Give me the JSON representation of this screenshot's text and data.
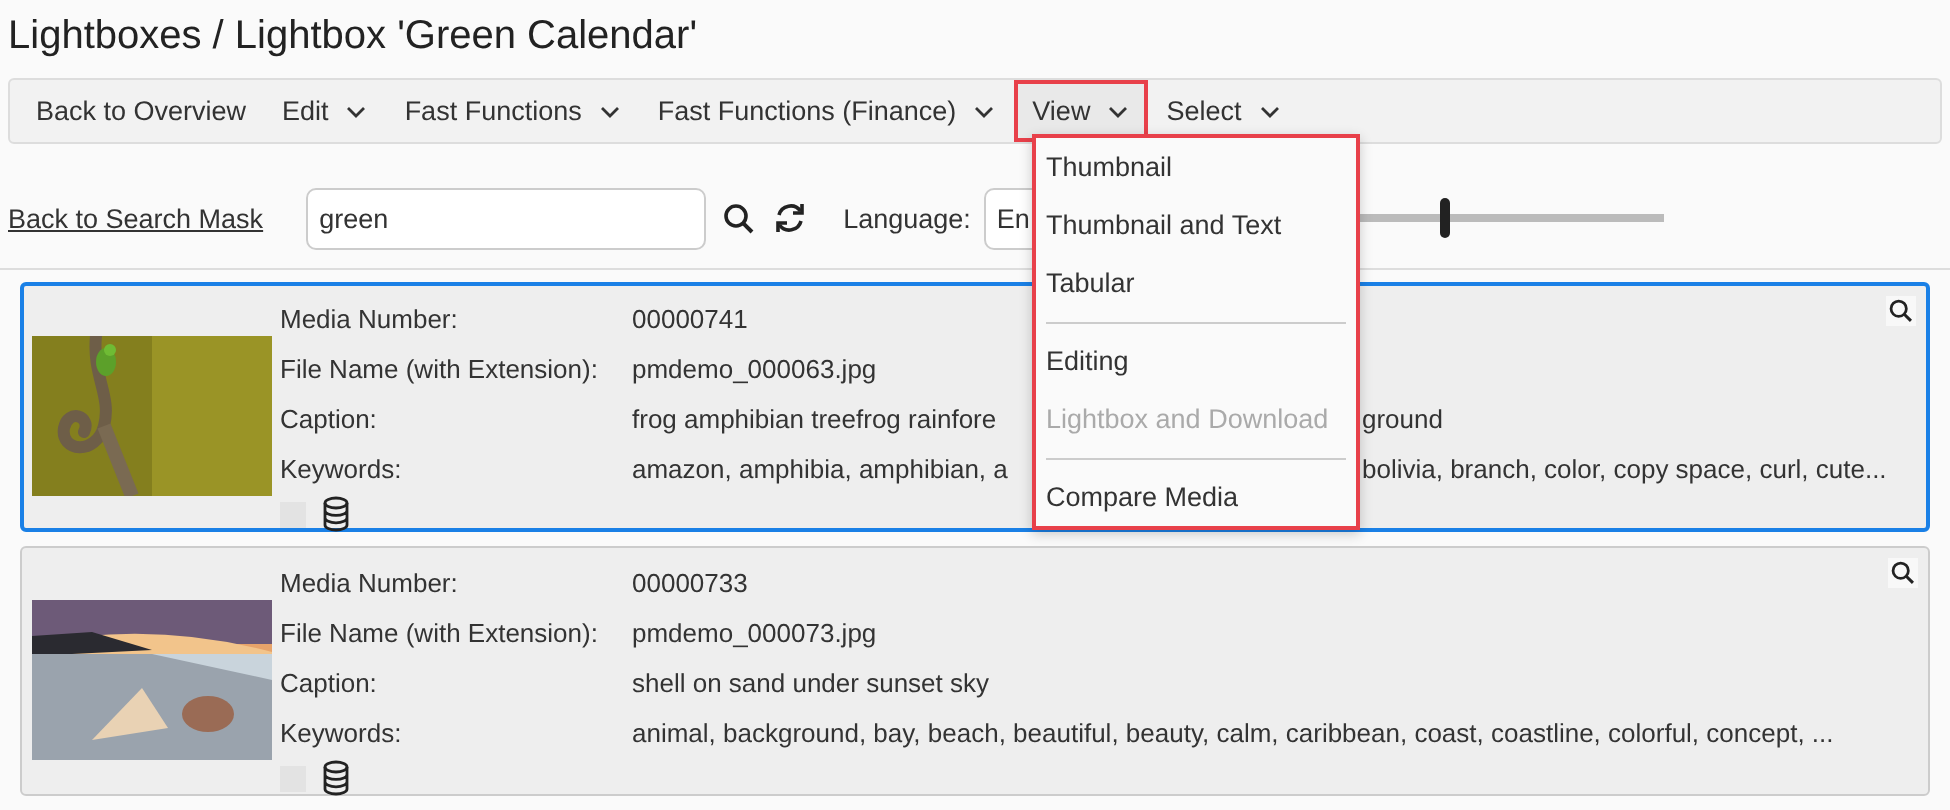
{
  "title": "Lightboxes / Lightbox 'Green Calendar'",
  "toolbar": [
    {
      "label": "Back to Overview",
      "has_caret": false,
      "selected": false
    },
    {
      "label": "Edit",
      "has_caret": true,
      "selected": false
    },
    {
      "label": "Fast Functions",
      "has_caret": true,
      "selected": false
    },
    {
      "label": "Fast Functions (Finance)",
      "has_caret": true,
      "selected": false
    },
    {
      "label": "View",
      "has_caret": true,
      "selected": true
    },
    {
      "label": "Select",
      "has_caret": true,
      "selected": false
    }
  ],
  "search": {
    "back_link": "Back to Search Mask",
    "query": "green",
    "language_label": "Language:",
    "language_value": "En",
    "size_slider": {
      "level": 0.55
    }
  },
  "view_menu": [
    {
      "kind": "item",
      "label": "Thumbnail",
      "disabled": false
    },
    {
      "kind": "item",
      "label": "Thumbnail and Text",
      "disabled": false
    },
    {
      "kind": "item",
      "label": "Tabular",
      "disabled": false
    },
    {
      "kind": "separator"
    },
    {
      "kind": "item",
      "label": "Editing",
      "disabled": false
    },
    {
      "kind": "item",
      "label": "Lightbox and Download",
      "disabled": true
    },
    {
      "kind": "separator"
    },
    {
      "kind": "item",
      "label": "Compare Media",
      "disabled": false
    }
  ],
  "cards": [
    {
      "selected": true,
      "checked": false,
      "fields": [
        {
          "label": "Media Number:",
          "value": "00000741"
        },
        {
          "label": "File Name (with Extension):",
          "value": "pmdemo_000063.jpg"
        },
        {
          "label": "Caption:",
          "value": "frog amphibian treefrog rainfore",
          "value_end": "ground"
        },
        {
          "label": "Keywords:",
          "value": "amazon, amphibia, amphibian, a",
          "value_end": "bolivia, branch, color, copy space, curl, cute..."
        }
      ]
    },
    {
      "selected": false,
      "checked": false,
      "fields": [
        {
          "label": "Media Number:",
          "value": "00000733"
        },
        {
          "label": "File Name (with Extension):",
          "value": "pmdemo_000073.jpg"
        },
        {
          "label": "Caption:",
          "value": "shell on sand under sunset sky"
        },
        {
          "label": "Keywords:",
          "value": "animal, background, bay, beach, beautiful, beauty, calm, caribbean, coast, coastline, colorful, concept, ..."
        }
      ]
    }
  ]
}
